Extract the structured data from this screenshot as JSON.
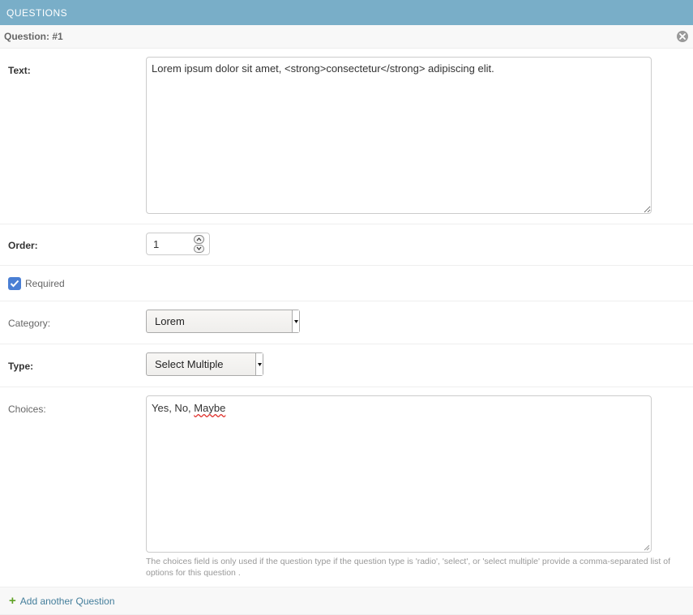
{
  "section": {
    "title": "QUESTIONS"
  },
  "inline": {
    "title": "Question: #1"
  },
  "fields": {
    "text": {
      "label": "Text:",
      "value": "Lorem ipsum dolor sit amet, <strong>consectetur</strong> adipiscing elit."
    },
    "order": {
      "label": "Order:",
      "value": "1"
    },
    "required": {
      "label": "Required",
      "checked": true
    },
    "category": {
      "label": "Category:",
      "selected": "Lorem"
    },
    "type": {
      "label": "Type:",
      "selected": "Select Multiple"
    },
    "choices": {
      "label": "Choices:",
      "value_prefix": "Yes, No, ",
      "value_misspelled": "Maybe",
      "help": "The choices field is only used if the question type if the question type is 'radio', 'select', or 'select multiple' provide a comma-separated list of options for this question ."
    }
  },
  "actions": {
    "add_another": "Add another Question"
  },
  "icons": {
    "delete": "close-circle-icon",
    "add": "plus-icon",
    "checkbox": "checkmark-icon",
    "dropdown": "triangle-down-icon"
  },
  "colors": {
    "header_bg": "#79aec8",
    "link": "#447e9b",
    "add_icon": "#5fa225",
    "checkbox": "#4a7fd4"
  }
}
